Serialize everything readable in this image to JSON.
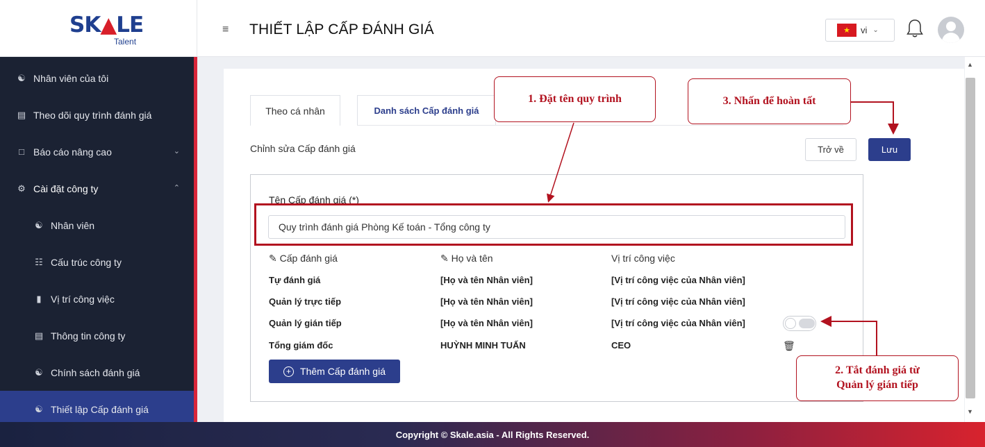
{
  "logo": {
    "main_pre": "SK",
    "main_a": "▲",
    "main_post": "LE",
    "sub": "Talent"
  },
  "header": {
    "title": "THIẾT LẬP CẤP ĐÁNH GIÁ",
    "lang": "vi"
  },
  "sidebar": {
    "items": [
      {
        "label": "Nhân viên của tôi",
        "icon": "user-group-icon"
      },
      {
        "label": "Theo dõi quy trình đánh giá",
        "icon": "clipboard-icon"
      },
      {
        "label": "Báo cáo nâng cao",
        "icon": "chart-icon"
      },
      {
        "label": "Cài đặt công ty",
        "icon": "gear-icon"
      },
      {
        "label": "Nhân viên",
        "icon": "user-group-icon"
      },
      {
        "label": "Cấu trúc công ty",
        "icon": "org-chart-icon"
      },
      {
        "label": "Vị trí công việc",
        "icon": "ticket-icon"
      },
      {
        "label": "Thông tin công ty",
        "icon": "clipboard-icon"
      },
      {
        "label": "Chính sách đánh giá",
        "icon": "user-group-icon"
      },
      {
        "label": "Thiết lập Cấp đánh giá",
        "icon": "user-group-icon"
      }
    ]
  },
  "tabs": {
    "individual": "Theo cá nhân",
    "levels": "Danh sách Cấp đánh giá"
  },
  "form": {
    "subtitle": "Chỉnh sửa Cấp đánh giá",
    "back": "Trở về",
    "save": "Lưu",
    "name_label": "Tên Cấp đánh giá (*)",
    "name_value": "Quy trình đánh giá Phòng Kế toán - Tổng công ty",
    "col_level": "Cấp đánh giá",
    "col_name": "Họ và tên",
    "col_position": "Vị trí công việc",
    "rows": [
      {
        "level": "Tự đánh giá",
        "name": "[Họ và tên Nhân viên]",
        "position": "[Vị trí công việc của Nhân viên]"
      },
      {
        "level": "Quản lý trực tiếp",
        "name": "[Họ và tên Nhân viên]",
        "position": "[Vị trí công việc của Nhân viên]"
      },
      {
        "level": "Quản lý gián tiếp",
        "name": "[Họ và tên Nhân viên]",
        "position": "[Vị trí công việc của Nhân viên]"
      },
      {
        "level": "Tổng giám đốc",
        "name": "HUỲNH MINH TUẤN",
        "position": "CEO"
      }
    ],
    "add_button": "Thêm Cấp đánh giá"
  },
  "annotations": {
    "step1": "1. Đặt tên quy trình",
    "step2_line1": "2. Tắt đánh giá từ",
    "step2_line2": "Quản lý gián tiếp",
    "step3": "3. Nhấn để hoàn tất",
    "color": "#b2121f"
  },
  "footer": "Copyright © Skale.asia - All Rights Reserved."
}
